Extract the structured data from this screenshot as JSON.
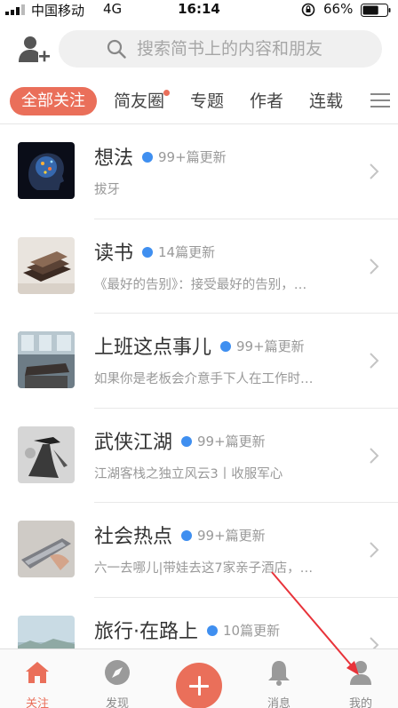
{
  "status_bar": {
    "carrier": "中国移动",
    "network": "4G",
    "time": "16:14",
    "battery_percent": "66%",
    "battery_level": 0.66
  },
  "header": {
    "search_placeholder": "搜索简书上的内容和朋友"
  },
  "tabs": [
    {
      "label": "全部关注",
      "active": true
    },
    {
      "label": "简友圈",
      "badge": true
    },
    {
      "label": "专题"
    },
    {
      "label": "作者"
    },
    {
      "label": "连载"
    }
  ],
  "list": [
    {
      "title": "想法",
      "count": "99+篇更新",
      "desc": "拔牙"
    },
    {
      "title": "读书",
      "count": "14篇更新",
      "desc": "《最好的告别》：接受最好的告别，…"
    },
    {
      "title": "上班这点事儿",
      "count": "99+篇更新",
      "desc": "如果你是老板会介意手下人在工作时…"
    },
    {
      "title": "武侠江湖",
      "count": "99+篇更新",
      "desc": "江湖客栈之独立风云3丨收服军心"
    },
    {
      "title": "社会热点",
      "count": "99+篇更新",
      "desc": "六一去哪儿|带娃去这7家亲子酒店，…"
    },
    {
      "title": "旅行·在路上",
      "count": "10篇更新",
      "desc": ""
    }
  ],
  "bottom_nav": {
    "follow_label": "关注",
    "discover_label": "发现",
    "messages_label": "消息",
    "mine_label": "我的"
  },
  "colors": {
    "accent": "#ea6f5a",
    "update_dot": "#3f8ff0",
    "annotation_arrow": "#e8333a"
  }
}
